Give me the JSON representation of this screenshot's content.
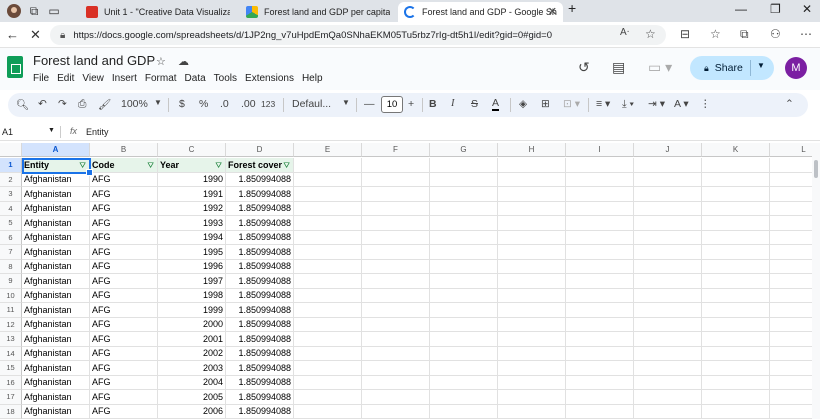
{
  "browser": {
    "tabs": [
      {
        "title": "Unit 1 - \"Creative Data Visualizat",
        "favicon_color": "#d93025"
      },
      {
        "title": "Forest land and GDP per capita",
        "favicon_color": "#fbbc04"
      },
      {
        "title": "Forest land and GDP - Google Sh",
        "favicon_color": "#1a73e8"
      }
    ],
    "new_tab": "+",
    "url": "https://docs.google.com/spreadsheets/d/1JP2ng_v7uHpdEmQa0SNhaEKM05Tu5rbz7rIg-dt5h1I/edit?gid=0#gid=0"
  },
  "doc": {
    "title": "Forest land and GDP",
    "menus": [
      "File",
      "Edit",
      "View",
      "Insert",
      "Format",
      "Data",
      "Tools",
      "Extensions",
      "Help"
    ],
    "share_label": "Share",
    "avatar_letter": "M"
  },
  "toolbar": {
    "zoom": "100%",
    "currency": "$",
    "percent": "%",
    "dec_decrease": ".0",
    "dec_increase": ".00",
    "more_formats": "123",
    "font": "Defaul...",
    "font_size": "10",
    "bold": "B",
    "italic": "I",
    "strike": "S",
    "text_color": "A"
  },
  "formula_bar": {
    "cell_ref": "A1",
    "fx": "fx",
    "content": "Entity"
  },
  "columns": [
    "A",
    "B",
    "C",
    "D",
    "E",
    "F",
    "G",
    "H",
    "I",
    "J",
    "K",
    "L"
  ],
  "header_row": [
    "Entity",
    "Code",
    "Year",
    "Forest cover"
  ],
  "rows": [
    [
      "Afghanistan",
      "AFG",
      "1990",
      "1.850994088"
    ],
    [
      "Afghanistan",
      "AFG",
      "1991",
      "1.850994088"
    ],
    [
      "Afghanistan",
      "AFG",
      "1992",
      "1.850994088"
    ],
    [
      "Afghanistan",
      "AFG",
      "1993",
      "1.850994088"
    ],
    [
      "Afghanistan",
      "AFG",
      "1994",
      "1.850994088"
    ],
    [
      "Afghanistan",
      "AFG",
      "1995",
      "1.850994088"
    ],
    [
      "Afghanistan",
      "AFG",
      "1996",
      "1.850994088"
    ],
    [
      "Afghanistan",
      "AFG",
      "1997",
      "1.850994088"
    ],
    [
      "Afghanistan",
      "AFG",
      "1998",
      "1.850994088"
    ],
    [
      "Afghanistan",
      "AFG",
      "1999",
      "1.850994088"
    ],
    [
      "Afghanistan",
      "AFG",
      "2000",
      "1.850994088"
    ],
    [
      "Afghanistan",
      "AFG",
      "2001",
      "1.850994088"
    ],
    [
      "Afghanistan",
      "AFG",
      "2002",
      "1.850994088"
    ],
    [
      "Afghanistan",
      "AFG",
      "2003",
      "1.850994088"
    ],
    [
      "Afghanistan",
      "AFG",
      "2004",
      "1.850994088"
    ],
    [
      "Afghanistan",
      "AFG",
      "2005",
      "1.850994088"
    ],
    [
      "Afghanistan",
      "AFG",
      "2006",
      "1.850994088"
    ]
  ],
  "colors": {
    "accent": "#1a73e8",
    "share_bg": "#c2e7ff",
    "header_fill": "#e6f4ea",
    "sheets_green": "#0f9d58"
  }
}
